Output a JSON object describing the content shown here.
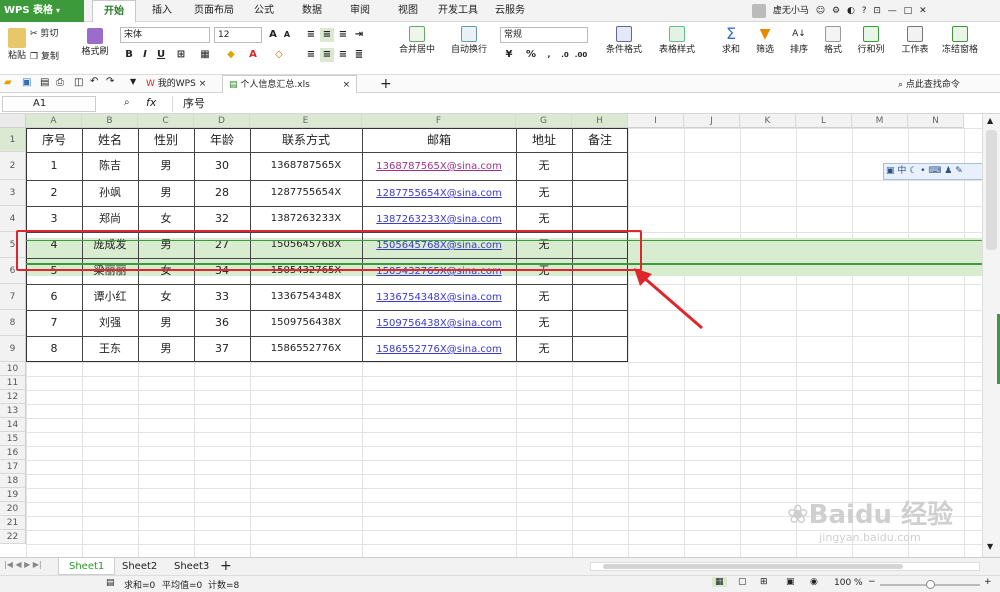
{
  "app": {
    "logo": "WPS 表格"
  },
  "menu": {
    "tabs": [
      "开始",
      "插入",
      "页面布局",
      "公式",
      "数据",
      "审阅",
      "视图",
      "开发工具",
      "云服务"
    ],
    "active_index": 0
  },
  "user": {
    "name": "虚无小马",
    "help": "?"
  },
  "ribbon": {
    "paste": "粘贴",
    "cut": "剪切",
    "copy": "复制",
    "format_painter": "格式刷",
    "font_name": "宋体",
    "font_size": "12",
    "bold": "B",
    "italic": "I",
    "underline": "U",
    "merge_center": "合并居中",
    "wrap_text": "自动换行",
    "number_format": "常规",
    "percent": "%",
    "cond_format": "条件格式",
    "table_style": "表格样式",
    "sum": "求和",
    "filter": "筛选",
    "sort": "排序",
    "format": "格式",
    "row_col": "行和列",
    "worksheet": "工作表",
    "freeze": "冻结窗格",
    "find_cmd": "点此查找命令"
  },
  "doc_tabs": [
    {
      "label": "我的WPS"
    },
    {
      "label": "个人信息汇总.xls"
    }
  ],
  "formula_bar": {
    "cell_ref": "A1",
    "fx": "fx",
    "value": "序号"
  },
  "columns": [
    "A",
    "B",
    "C",
    "D",
    "E",
    "F",
    "G",
    "H",
    "I",
    "J",
    "K",
    "L",
    "M",
    "N"
  ],
  "row_numbers": [
    "1",
    "2",
    "3",
    "4",
    "5",
    "6",
    "7",
    "8",
    "9",
    "10",
    "11",
    "12",
    "13",
    "14",
    "15",
    "16",
    "17",
    "18",
    "19",
    "20",
    "21",
    "22"
  ],
  "table": {
    "headers": [
      "序号",
      "姓名",
      "性别",
      "年龄",
      "联系方式",
      "邮箱",
      "地址",
      "备注"
    ],
    "rows": [
      [
        "1",
        "陈吉",
        "男",
        "30",
        "1368787565X",
        "1368787565X@sina.com",
        "无",
        ""
      ],
      [
        "2",
        "孙飒",
        "男",
        "28",
        "1287755654X",
        "1287755654X@sina.com",
        "无",
        ""
      ],
      [
        "3",
        "郑尚",
        "女",
        "32",
        "1387263233X",
        "1387263233X@sina.com",
        "无",
        ""
      ],
      [
        "4",
        "庞成发",
        "男",
        "27",
        "1505645768X",
        "1505645768X@sina.com",
        "无",
        ""
      ],
      [
        "5",
        "梁丽丽",
        "女",
        "34",
        "1505432765X",
        "1505432765X@sina.com",
        "无",
        ""
      ],
      [
        "6",
        "谭小红",
        "女",
        "33",
        "1336754348X",
        "1336754348X@sina.com",
        "无",
        ""
      ],
      [
        "7",
        "刘强",
        "男",
        "36",
        "1509756438X",
        "1509756438X@sina.com",
        "无",
        ""
      ],
      [
        "8",
        "王东",
        "男",
        "37",
        "1586552776X",
        "1586552776X@sina.com",
        "无",
        ""
      ]
    ]
  },
  "float_toolbar": {
    "lang": "中"
  },
  "sheets": [
    "Sheet1",
    "Sheet2",
    "Sheet3"
  ],
  "active_sheet": 0,
  "status": {
    "sum": "求和=0",
    "avg": "平均值=0",
    "count": "计数=8",
    "zoom": "100 %"
  },
  "watermark": {
    "text": "Baidu 经验",
    "url": "jingyan.baidu.com"
  },
  "colors": {
    "accent_green": "#3d9a3a",
    "header_fill": "#d8eccf",
    "annotation_red": "#e0262d",
    "link_blue": "#3a3acb"
  }
}
